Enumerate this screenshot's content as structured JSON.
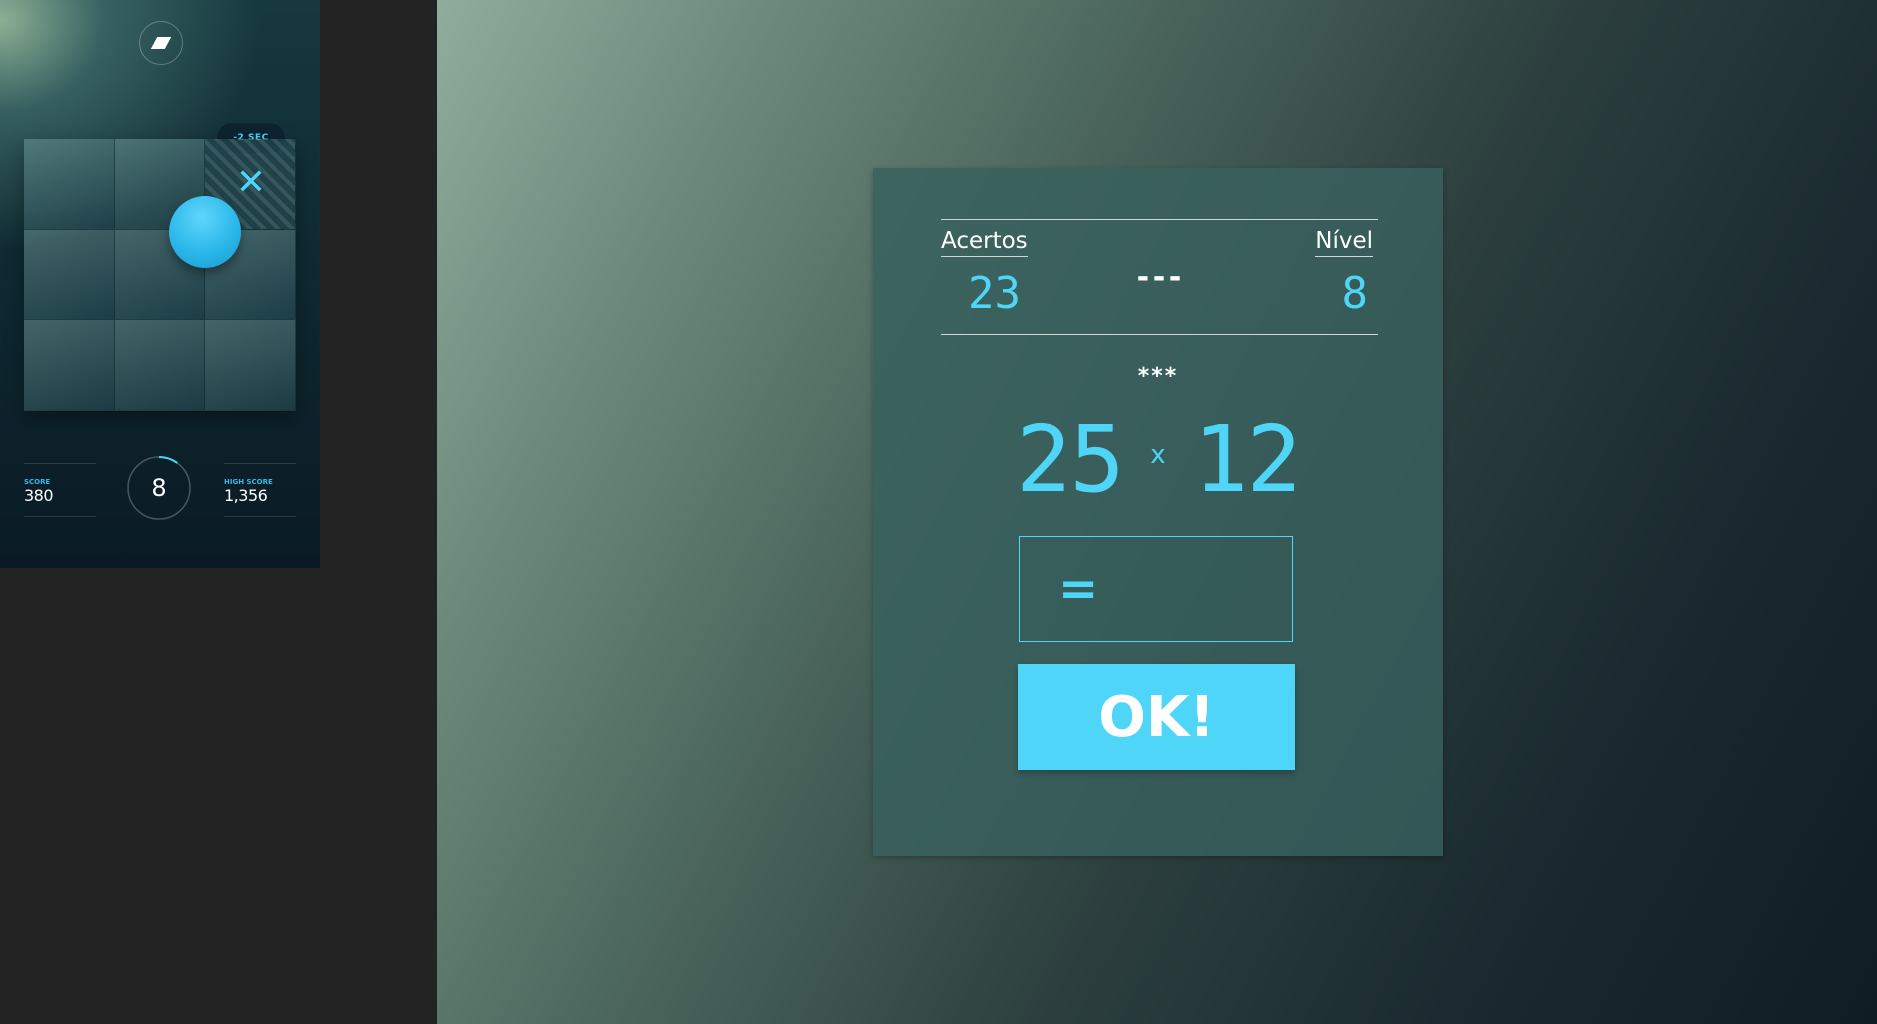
{
  "preview": {
    "badge": "-2 SEC",
    "score_label": "SCORE",
    "score_value": "380",
    "timer_value": "8",
    "timer_progress": 0.1,
    "high_score_label": "HIGH SCORE",
    "high_score_value": "1,356"
  },
  "game": {
    "hits_label": "Acertos",
    "hits_value": "23",
    "separator": "---",
    "level_label": "Nível",
    "level_value": "8",
    "stars": "***",
    "operand_a": "25",
    "operator": "x",
    "operand_b": "12",
    "equals": "=",
    "answer_value": "",
    "ok_label": "OK!"
  },
  "colors": {
    "accent": "#4fd5f7",
    "card": "#38605e",
    "page_dark": "#232323"
  }
}
